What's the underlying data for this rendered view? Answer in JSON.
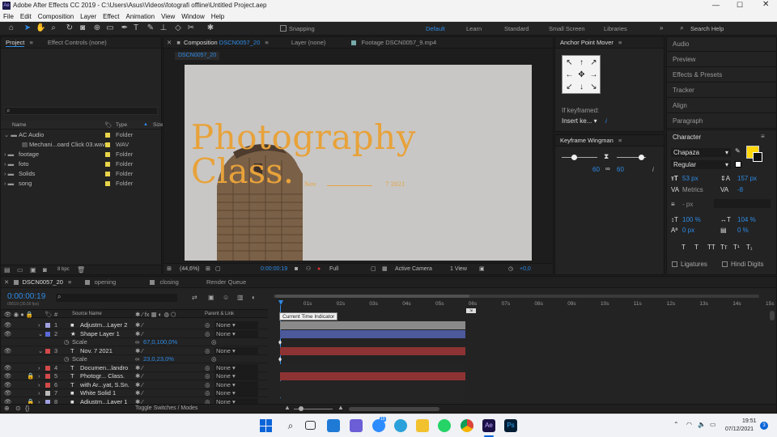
{
  "app": {
    "title": "Adobe After Effects CC 2019 - C:\\Users\\Asus\\Videos\\fotografi offline\\Untitled Project.aep",
    "icon_label": "Ae"
  },
  "menu": [
    "File",
    "Edit",
    "Composition",
    "Layer",
    "Effect",
    "Animation",
    "View",
    "Window",
    "Help"
  ],
  "toolbar": {
    "snapping": "Snapping",
    "workspaces": [
      "Default",
      "Learn",
      "Standard",
      "Small Screen",
      "Libraries"
    ],
    "search_placeholder": "Search Help"
  },
  "project_panel": {
    "tabs": [
      "Project",
      "Effect Controls (none)"
    ],
    "search_icon": "search-icon",
    "columns": [
      "Name",
      "Type",
      "Size"
    ],
    "items": [
      {
        "name": "AC Audio",
        "type": "Folder",
        "color": "#e8d34a",
        "expanded": true
      },
      {
        "name": "Mechani...oard Click 03.wav",
        "type": "WAV",
        "color": "#e8d34a",
        "child": true
      },
      {
        "name": "footage",
        "type": "Folder",
        "color": "#e8d34a"
      },
      {
        "name": "foto",
        "type": "Folder",
        "color": "#e8d34a"
      },
      {
        "name": "Solids",
        "type": "Folder",
        "color": "#e8d34a"
      },
      {
        "name": "song",
        "type": "Folder",
        "color": "#e8d34a"
      }
    ],
    "bpc": "8 bpc"
  },
  "composition_panel": {
    "tabs": [
      {
        "prefix": "Composition",
        "name": "DSCN0057_20"
      },
      {
        "prefix": "Layer",
        "name": "(none)"
      },
      {
        "prefix": "Footage",
        "name": "DSCN0057_9.mp4"
      }
    ],
    "sub_tab": "DSCN0057_20",
    "canvas": {
      "title_line1": "Photography",
      "title_line2": "Class.",
      "small_left": "Nov.",
      "small_right": "7 2021"
    },
    "footer": {
      "zoom": "(44,6%)",
      "time": "0:00:00:19",
      "quality": "Full",
      "camera": "Active Camera",
      "views": "1 View",
      "exposure": "+0,0"
    }
  },
  "anchor_panel": {
    "title": "Anchor Point Mover",
    "keyframed_label": "If keyframed:",
    "keyframed_value": "Insert ke...",
    "arrows": [
      "↖",
      "↑",
      "↗",
      "←",
      "✥",
      "→",
      "↙",
      "↓",
      "↘"
    ]
  },
  "wingman_panel": {
    "title": "Keyframe Wingman",
    "left_value": "60",
    "right_value": "60"
  },
  "side_panels": [
    "Audio",
    "Preview",
    "Effects & Presets",
    "Tracker",
    "Align",
    "Paragraph"
  ],
  "character_panel": {
    "title": "Character",
    "font": "Chapaza",
    "style": "Regular",
    "size": "53 px",
    "leading": "157 px",
    "kerning": "Metrics",
    "tracking": "-8",
    "stroke_unit": "- px",
    "vscale": "100 %",
    "hscale": "104 %",
    "baseline": "0 px",
    "tsume": "0 %",
    "fill_color": "#ffd60a",
    "styles": [
      "T",
      "T",
      "TT",
      "Tт",
      "T¹",
      "T₁"
    ],
    "ligatures": "Ligatures",
    "hindi": "Hindi Digits"
  },
  "timeline": {
    "tabs": [
      "DSCN0057_20",
      "opening",
      "closing",
      "Render Queue"
    ],
    "timecode": "0:00:00:19",
    "timecode_sub": "00019 (30.00 fps)",
    "col_source": "Source Name",
    "col_parent": "Parent & Link",
    "ruler": [
      "01s",
      "02s",
      "03s",
      "04s",
      "05s",
      "06s",
      "07s",
      "08s",
      "09s",
      "10s",
      "11s",
      "12s",
      "13s",
      "14s",
      "15s"
    ],
    "tooltip": "Current Time Indicator",
    "toggle_label": "Toggle Switches / Modes",
    "layers": [
      {
        "num": "1",
        "name": "Adjustm...Layer 2",
        "color": "#a0a0e0",
        "parent": "None",
        "bar": "#8a8a8a",
        "icon": "■"
      },
      {
        "num": "2",
        "name": "Shape Layer 1",
        "color": "#5a6ad6",
        "parent": "None",
        "bar": "#4c5a9c",
        "icon": "★",
        "expanded": true
      },
      {
        "prop": true,
        "name": "Scale",
        "value": "67,0,100,0%"
      },
      {
        "num": "3",
        "name": "Nov.          7 2021",
        "color": "#d34a4a",
        "parent": "None",
        "bar": "#8e3333",
        "icon": "T",
        "expanded": true
      },
      {
        "prop": true,
        "name": "Scale",
        "value": "23,0,23,0%"
      },
      {
        "num": "4",
        "name": "Documen...landro",
        "color": "#d34a4a",
        "parent": "None",
        "bar": "",
        "icon": "T"
      },
      {
        "num": "5",
        "name": "Photogr... Class.",
        "color": "#d34a4a",
        "parent": "None",
        "bar": "#8e3333",
        "icon": "T"
      },
      {
        "num": "6",
        "name": "with Ar...yat, S.Sn.",
        "color": "#d34a4a",
        "parent": "None",
        "bar": "",
        "icon": "T"
      },
      {
        "num": "7",
        "name": "White Solid 1",
        "color": "#bbbbbb",
        "parent": "None",
        "bar": "",
        "icon": "■"
      },
      {
        "num": "8",
        "name": "Adjustm...Layer 1",
        "color": "#a0a0e0",
        "parent": "None",
        "bar": "",
        "icon": "■"
      }
    ]
  },
  "taskbar": {
    "time": "19:51",
    "date": "07/12/2021",
    "notif": "3",
    "badge": "10"
  }
}
